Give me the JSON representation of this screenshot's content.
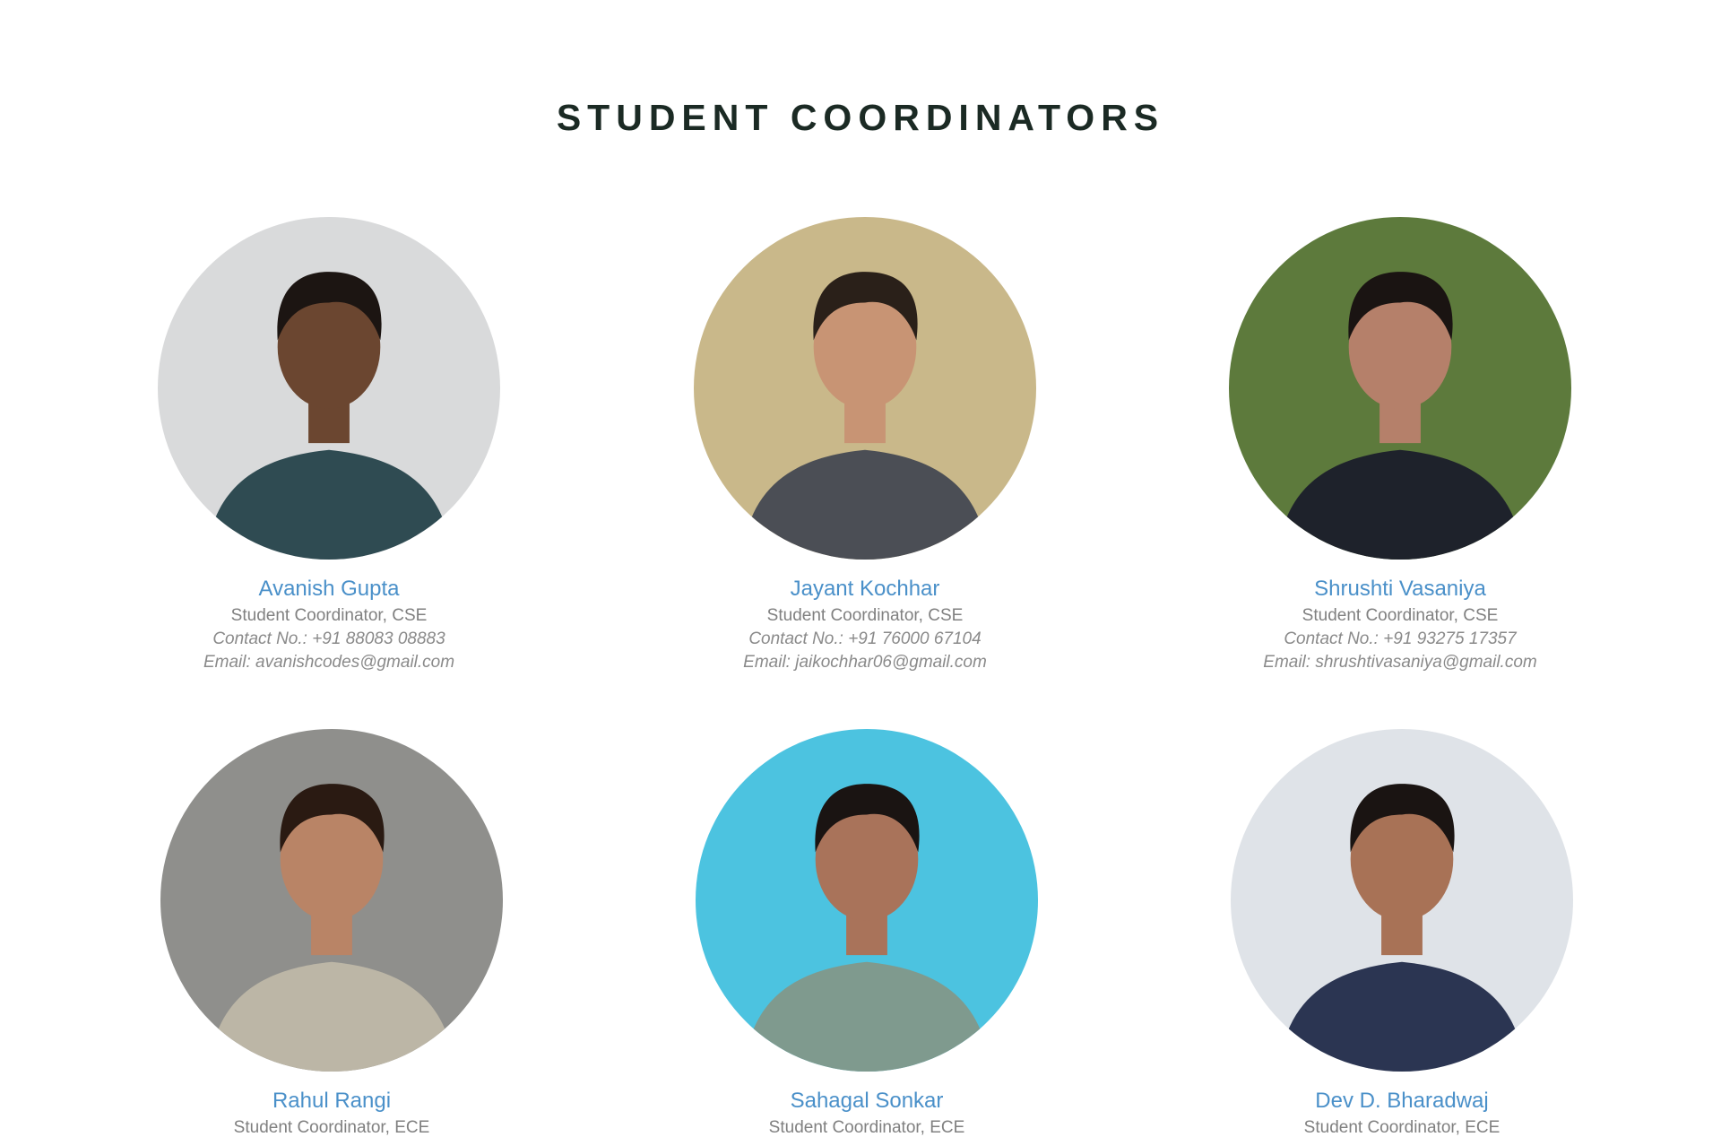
{
  "section": {
    "title": "STUDENT COORDINATORS"
  },
  "coordinators": [
    {
      "name": "Avanish Gupta",
      "role": "Student Coordinator, CSE",
      "contact": "Contact No.: +91 88083 08883",
      "email": "Email: avanishcodes@gmail.com",
      "photo_bg": "#d9dadb",
      "photo_skin": "#6b4630",
      "photo_hair": "#1c1512",
      "photo_shirt": "#2f4b52"
    },
    {
      "name": "Jayant Kochhar",
      "role": "Student Coordinator, CSE",
      "contact": "Contact No.: +91 76000 67104",
      "email": "Email: jaikochhar06@gmail.com",
      "photo_bg": "#c9b88a",
      "photo_skin": "#c89474",
      "photo_hair": "#2a2019",
      "photo_shirt": "#4b4e55"
    },
    {
      "name": "Shrushti Vasaniya",
      "role": "Student Coordinator, CSE",
      "contact": "Contact No.: +91 93275 17357",
      "email": "Email: shrushtivasaniya@gmail.com",
      "photo_bg": "#5d7a3c",
      "photo_skin": "#b5806a",
      "photo_hair": "#1a1412",
      "photo_shirt": "#1e222b"
    },
    {
      "name": "Rahul Rangi",
      "role": "Student Coordinator, ECE",
      "contact": "",
      "email": "",
      "photo_bg": "#8f8f8c",
      "photo_skin": "#b98466",
      "photo_hair": "#2a1a12",
      "photo_shirt": "#bcb6a6"
    },
    {
      "name": "Sahagal Sonkar",
      "role": "Student Coordinator, ECE",
      "contact": "",
      "email": "",
      "photo_bg": "#4cc3e0",
      "photo_skin": "#a9735a",
      "photo_hair": "#1a1412",
      "photo_shirt": "#7f9a8e"
    },
    {
      "name": "Dev D. Bharadwaj",
      "role": "Student Coordinator, ECE",
      "contact": "",
      "email": "",
      "photo_bg": "#dfe3e8",
      "photo_skin": "#a87256",
      "photo_hair": "#1a1412",
      "photo_shirt": "#2b3552"
    }
  ]
}
